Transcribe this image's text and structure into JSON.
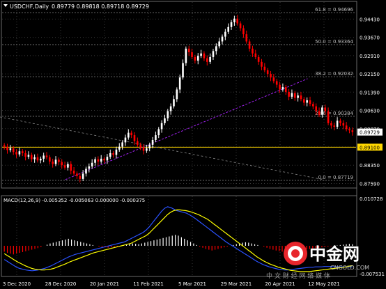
{
  "header": {
    "symbol_tf": "USDCHF,Daily",
    "ohlc": "0.89779 0.89818 0.89718 0.89729"
  },
  "macd_header": {
    "label": "MACD(12,26,9) -0.005352 -0.005063 0.000000 -0.000375"
  },
  "colors": {
    "background": "#000000",
    "grid": "#3a3a3a",
    "bull_candle": "#ffffff",
    "bear_candle": "#ff0000",
    "fib_line": "#8a8a8a",
    "support_line": "#ffd700",
    "trend_line": "#a020f0",
    "macd_main": "#2a52ff",
    "macd_signal": "#ffff00",
    "histogram_pos": "#ffffff",
    "histogram_neg": "#ff0000",
    "price_tag_current": "#ffffff",
    "price_tag_support": "#ffd700",
    "logo_red": "#e8262c"
  },
  "price_axis": {
    "labels": [
      "0.94430",
      "0.93670",
      "0.92910",
      "0.92150",
      "0.91390",
      "0.90630",
      "0.89870",
      "0.89110",
      "0.88350",
      "0.87590"
    ],
    "current_price": "0.89729",
    "support_price": "0.89100"
  },
  "macd_axis": {
    "top_label": "0.010728",
    "bottom_label": "-0.007531"
  },
  "fib_levels": [
    {
      "label": "61.8 = 0.94696",
      "value": 0.94696
    },
    {
      "label": "50.0 = 0.93364",
      "value": 0.93364
    },
    {
      "label": "38.2 = 0.92032",
      "value": 0.92032
    },
    {
      "label": "23.6 = 0.90384",
      "value": 0.90384
    },
    {
      "label": "0.0 = 0.87719",
      "value": 0.87719
    }
  ],
  "time_axis": {
    "labels": [
      "3 Dec 2020",
      "28 Dec 2020",
      "20 Jan 2021",
      "11 Feb 2021",
      "5 Mar 2021",
      "29 Mar 2021",
      "20 Apr 2021",
      "12 May 2021"
    ]
  },
  "watermark": {
    "logo_text": "中金网",
    "url": "CNGOLD.COM",
    "tagline": "中 文 财 经 网 络 媒 体"
  },
  "chart_data": {
    "type": "candlestick",
    "symbol": "USDCHF",
    "timeframe": "Daily",
    "ylim": [
      0.874,
      0.9505
    ],
    "closes": [
      0.8912,
      0.8898,
      0.8905,
      0.889,
      0.888,
      0.8893,
      0.8885,
      0.887,
      0.8878,
      0.886,
      0.8868,
      0.8855,
      0.8862,
      0.8875,
      0.8868,
      0.885,
      0.884,
      0.8858,
      0.8848,
      0.8835,
      0.8825,
      0.884,
      0.8812,
      0.88,
      0.879,
      0.8778,
      0.88,
      0.882,
      0.883,
      0.8845,
      0.886,
      0.885,
      0.8862,
      0.8855,
      0.887,
      0.8885,
      0.8878,
      0.89,
      0.8912,
      0.893,
      0.895,
      0.897,
      0.896,
      0.8935,
      0.892,
      0.891,
      0.8895,
      0.8905,
      0.892,
      0.894,
      0.896,
      0.8985,
      0.901,
      0.903,
      0.906,
      0.908,
      0.911,
      0.915,
      0.92,
      0.926,
      0.932,
      0.9305,
      0.9285,
      0.927,
      0.929,
      0.93,
      0.928,
      0.9265,
      0.9285,
      0.931,
      0.933,
      0.935,
      0.937,
      0.939,
      0.941,
      0.943,
      0.9445,
      0.9425,
      0.9405,
      0.938,
      0.935,
      0.932,
      0.93,
      0.9285,
      0.9265,
      0.9245,
      0.923,
      0.9215,
      0.92,
      0.9185,
      0.917,
      0.915,
      0.916,
      0.914,
      0.912,
      0.9135,
      0.9115,
      0.9125,
      0.911,
      0.9095,
      0.9105,
      0.909,
      0.908,
      0.906,
      0.9045,
      0.9075,
      0.906,
      0.901,
      0.9,
      0.8995,
      0.902,
      0.901,
      0.9,
      0.8985,
      0.898,
      0.8973
    ]
  },
  "macd_data": {
    "ylim": [
      -0.0075,
      0.0107
    ],
    "hist": [
      -0.0015,
      -0.0018,
      -0.002,
      -0.0022,
      -0.002,
      -0.0018,
      -0.0016,
      -0.0014,
      -0.0012,
      -0.001,
      -0.0008,
      -0.0006,
      -0.0003,
      0.0,
      0.0003,
      0.0006,
      0.0008,
      0.001,
      0.0012,
      0.0014,
      0.0016,
      0.0018,
      0.0016,
      0.0014,
      0.0012,
      0.001,
      0.0008,
      0.0006,
      0.0004,
      0.0002,
      0.0,
      -0.0002,
      -0.0003,
      -0.0004,
      -0.0005,
      -0.0004,
      -0.0003,
      -0.0002,
      -0.0001,
      0.0001,
      0.0003,
      0.0005,
      0.0006,
      0.0005,
      0.0004,
      0.0006,
      0.0008,
      0.001,
      0.0012,
      0.0014,
      0.0016,
      0.0018,
      0.002,
      0.0022,
      0.0024,
      0.0026,
      0.0028,
      0.0026,
      0.0022,
      0.0018,
      0.0014,
      0.001,
      0.0006,
      0.0002,
      -0.0002,
      -0.0005,
      -0.0008,
      -0.001,
      -0.0012,
      -0.001,
      -0.0008,
      -0.0006,
      -0.0004,
      -0.0002,
      0.0,
      0.0002,
      0.0004,
      0.0006,
      0.0008,
      0.0009,
      0.0008,
      0.0006,
      0.0004,
      0.0002,
      0.0,
      -0.0002,
      -0.0005,
      -0.0008,
      -0.001,
      -0.0012,
      -0.0014,
      -0.0015,
      -0.0016,
      -0.0015,
      -0.0014,
      -0.0013,
      -0.0012,
      -0.0011,
      -0.001,
      -0.0009,
      -0.0008,
      -0.0007,
      -0.0006,
      -0.0005,
      -0.0004,
      -0.0003,
      -0.0002,
      -0.0001,
      0.0,
      0.0001,
      0.0002,
      0.0003,
      0.0004,
      0.0005,
      0.0004
    ],
    "main": [
      -0.0035,
      -0.004,
      -0.0045,
      -0.005,
      -0.0055,
      -0.0058,
      -0.006,
      -0.0062,
      -0.0063,
      -0.0064,
      -0.0063,
      -0.0062,
      -0.006,
      -0.0058,
      -0.0055,
      -0.0052,
      -0.0048,
      -0.0044,
      -0.004,
      -0.0036,
      -0.0032,
      -0.0028,
      -0.0025,
      -0.0022,
      -0.002,
      -0.0018,
      -0.0016,
      -0.0014,
      -0.0012,
      -0.001,
      -0.0008,
      -0.0006,
      -0.0004,
      -0.0002,
      0.0,
      0.0002,
      0.0004,
      0.0006,
      0.0008,
      0.001,
      0.0014,
      0.0018,
      0.0022,
      0.0026,
      0.003,
      0.0034,
      0.004,
      0.0048,
      0.0058,
      0.0068,
      0.0078,
      0.0088,
      0.0096,
      0.01,
      0.0098,
      0.0094,
      0.009,
      0.0088,
      0.0086,
      0.0084,
      0.008,
      0.0075,
      0.007,
      0.0064,
      0.0058,
      0.0052,
      0.0046,
      0.004,
      0.0034,
      0.0028,
      0.0022,
      0.0016,
      0.001,
      0.0005,
      0.0,
      -0.0005,
      -0.001,
      -0.0015,
      -0.002,
      -0.0025,
      -0.003,
      -0.0035,
      -0.004,
      -0.0044,
      -0.0048,
      -0.0051,
      -0.0054,
      -0.0056,
      -0.0058,
      -0.006,
      -0.0061,
      -0.0062,
      -0.0062,
      -0.0061,
      -0.006,
      -0.0059,
      -0.0058,
      -0.0057,
      -0.0056,
      -0.0055,
      -0.0055,
      -0.0054,
      -0.0054,
      -0.0054,
      -0.0053,
      -0.0053,
      -0.0053,
      -0.0054,
      -0.0054,
      -0.0054,
      -0.0054,
      -0.0054,
      -0.0054,
      -0.0054
    ],
    "signal": [
      -0.002,
      -0.0025,
      -0.003,
      -0.0035,
      -0.004,
      -0.0044,
      -0.0048,
      -0.0052,
      -0.0055,
      -0.0058,
      -0.006,
      -0.0061,
      -0.0062,
      -0.0062,
      -0.0061,
      -0.006,
      -0.0058,
      -0.0055,
      -0.0052,
      -0.0049,
      -0.0046,
      -0.0042,
      -0.0039,
      -0.0036,
      -0.0033,
      -0.003,
      -0.0027,
      -0.0024,
      -0.0021,
      -0.0018,
      -0.0016,
      -0.0014,
      -0.0012,
      -0.001,
      -0.0008,
      -0.0006,
      -0.0004,
      -0.0002,
      0.0,
      0.0002,
      0.0004,
      0.0006,
      0.001,
      0.0014,
      0.0018,
      0.0022,
      0.0026,
      0.0032,
      0.004,
      0.0048,
      0.0056,
      0.0064,
      0.0072,
      0.008,
      0.0086,
      0.009,
      0.0092,
      0.0092,
      0.0091,
      0.009,
      0.0088,
      0.0086,
      0.0083,
      0.008,
      0.0076,
      0.0072,
      0.0068,
      0.0062,
      0.0056,
      0.005,
      0.0044,
      0.0038,
      0.0032,
      0.0026,
      0.002,
      0.0014,
      0.0008,
      0.0002,
      -0.0004,
      -0.001,
      -0.0016,
      -0.0022,
      -0.0028,
      -0.0033,
      -0.0038,
      -0.0042,
      -0.0046,
      -0.0049,
      -0.0052,
      -0.0055,
      -0.0057,
      -0.0059,
      -0.0061,
      -0.0063,
      -0.0064,
      -0.0065,
      -0.0066,
      -0.0066,
      -0.0066,
      -0.0066,
      -0.0065,
      -0.0064,
      -0.0063,
      -0.0062,
      -0.0061,
      -0.006,
      -0.0059,
      -0.0058,
      -0.0057,
      -0.0056,
      -0.0055,
      -0.0054,
      -0.0052,
      -0.0051
    ]
  },
  "trend_line_points": [
    {
      "i": 10,
      "v": 0.9005
    },
    {
      "i": 110,
      "v": 0.8775
    }
  ],
  "uptrend_points": [
    {
      "i": 22,
      "v": 0.8775
    },
    {
      "i": 114,
      "v": 0.9195
    }
  ]
}
